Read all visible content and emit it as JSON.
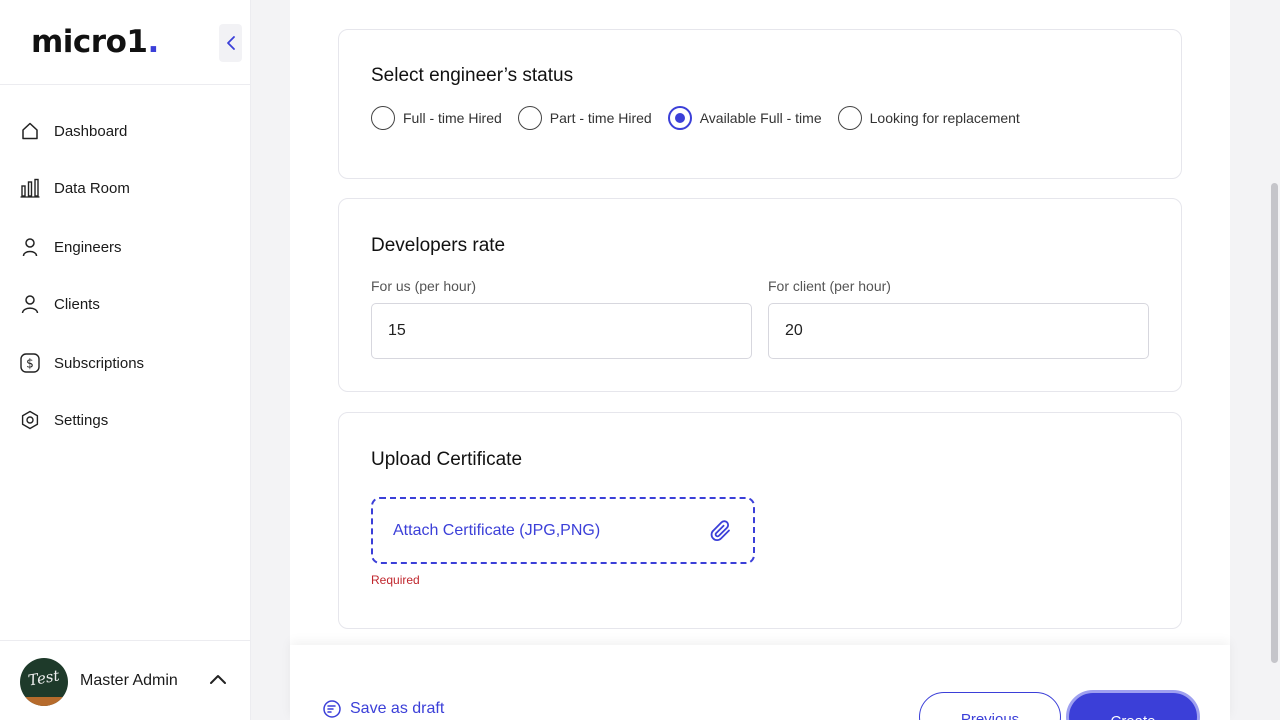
{
  "app": {
    "logo_text": "micro1",
    "logo_dot": ".",
    "accent": "#3b3fd8"
  },
  "sidebar": {
    "items": [
      {
        "label": "Dashboard",
        "icon": "home-icon"
      },
      {
        "label": "Data Room",
        "icon": "bar-chart-icon"
      },
      {
        "label": "Engineers",
        "icon": "person-icon"
      },
      {
        "label": "Clients",
        "icon": "user-icon"
      },
      {
        "label": "Subscriptions",
        "icon": "dollar-icon"
      },
      {
        "label": "Settings",
        "icon": "gear-icon"
      }
    ],
    "user": {
      "name": "Master Admin",
      "avatar_text": "Test"
    }
  },
  "status_section": {
    "title": "Select engineer’s status",
    "options": [
      {
        "label": "Full - time Hired",
        "checked": false
      },
      {
        "label": "Part - time Hired",
        "checked": false
      },
      {
        "label": "Available Full - time",
        "checked": true
      },
      {
        "label": "Looking for replacement",
        "checked": false
      }
    ]
  },
  "rate_section": {
    "title": "Developers rate",
    "for_us_label": "For us (per hour)",
    "for_us_value": "15",
    "for_client_label": "For client (per hour)",
    "for_client_value": "20"
  },
  "upload_section": {
    "title": "Upload Certificate",
    "attach_label": "Attach Certificate (JPG,PNG)",
    "error": "Required"
  },
  "footer": {
    "draft_label": "Save as draft",
    "previous_label": "Previous",
    "create_label": "Create"
  }
}
